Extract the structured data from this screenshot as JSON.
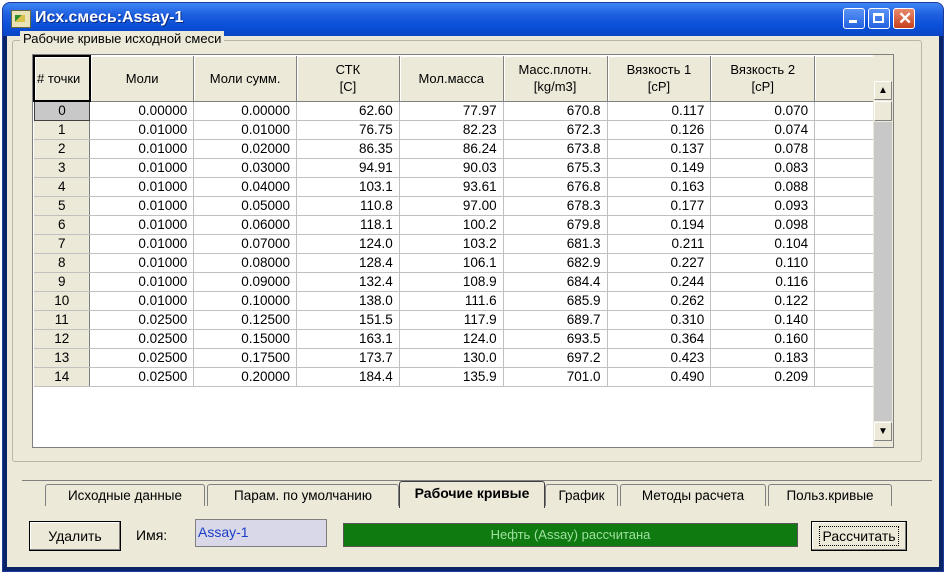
{
  "window": {
    "title": "Исх.смесь:Assay-1"
  },
  "group": {
    "label": "Рабочие кривые исходной смеси"
  },
  "table": {
    "headers": [
      {
        "line1": "# точки",
        "line2": ""
      },
      {
        "line1": "Моли",
        "line2": ""
      },
      {
        "line1": "Моли сумм.",
        "line2": ""
      },
      {
        "line1": "СТК",
        "line2": "[C]"
      },
      {
        "line1": "Мол.масса",
        "line2": ""
      },
      {
        "line1": "Масс.плотн.",
        "line2": "[kg/m3]"
      },
      {
        "line1": "Вязкость 1",
        "line2": "[cP]"
      },
      {
        "line1": "Вязкость 2",
        "line2": "[cP]"
      }
    ],
    "rows": [
      [
        "0",
        "0.00000",
        "0.00000",
        "62.60",
        "77.97",
        "670.8",
        "0.117",
        "0.070"
      ],
      [
        "1",
        "0.01000",
        "0.01000",
        "76.75",
        "82.23",
        "672.3",
        "0.126",
        "0.074"
      ],
      [
        "2",
        "0.01000",
        "0.02000",
        "86.35",
        "86.24",
        "673.8",
        "0.137",
        "0.078"
      ],
      [
        "3",
        "0.01000",
        "0.03000",
        "94.91",
        "90.03",
        "675.3",
        "0.149",
        "0.083"
      ],
      [
        "4",
        "0.01000",
        "0.04000",
        "103.1",
        "93.61",
        "676.8",
        "0.163",
        "0.088"
      ],
      [
        "5",
        "0.01000",
        "0.05000",
        "110.8",
        "97.00",
        "678.3",
        "0.177",
        "0.093"
      ],
      [
        "6",
        "0.01000",
        "0.06000",
        "118.1",
        "100.2",
        "679.8",
        "0.194",
        "0.098"
      ],
      [
        "7",
        "0.01000",
        "0.07000",
        "124.0",
        "103.2",
        "681.3",
        "0.211",
        "0.104"
      ],
      [
        "8",
        "0.01000",
        "0.08000",
        "128.4",
        "106.1",
        "682.9",
        "0.227",
        "0.110"
      ],
      [
        "9",
        "0.01000",
        "0.09000",
        "132.4",
        "108.9",
        "684.4",
        "0.244",
        "0.116"
      ],
      [
        "10",
        "0.01000",
        "0.10000",
        "138.0",
        "111.6",
        "685.9",
        "0.262",
        "0.122"
      ],
      [
        "11",
        "0.02500",
        "0.12500",
        "151.5",
        "117.9",
        "689.7",
        "0.310",
        "0.140"
      ],
      [
        "12",
        "0.02500",
        "0.15000",
        "163.1",
        "124.0",
        "693.5",
        "0.364",
        "0.160"
      ],
      [
        "13",
        "0.02500",
        "0.17500",
        "173.7",
        "130.0",
        "697.2",
        "0.423",
        "0.183"
      ],
      [
        "14",
        "0.02500",
        "0.20000",
        "184.4",
        "135.9",
        "701.0",
        "0.490",
        "0.209"
      ]
    ]
  },
  "tabs": [
    {
      "label": "Исходные данные"
    },
    {
      "label": "Парам. по умолчанию"
    },
    {
      "label": "Рабочие кривые",
      "active": true
    },
    {
      "label": "График"
    },
    {
      "label": "Методы расчета"
    },
    {
      "label": "Польз.кривые"
    }
  ],
  "bottom": {
    "delete_label": "Удалить",
    "name_label": "Имя:",
    "name_value": "Assay-1",
    "status_text": "Нефть (Assay) рассчитана",
    "calc_label": "Рассчитать"
  },
  "colors": {
    "status_bg": "#0f7a10",
    "titlebar": "#1f5fe0"
  }
}
